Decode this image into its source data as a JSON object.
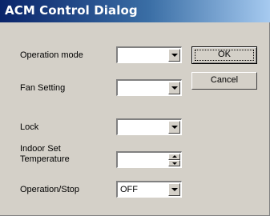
{
  "window": {
    "title": "ACM Control Dialog"
  },
  "form": {
    "operation_mode": {
      "label": "Operation mode",
      "value": ""
    },
    "fan_setting": {
      "label": "Fan Setting",
      "value": ""
    },
    "lock": {
      "label": "Lock",
      "value": ""
    },
    "indoor_set_temperature": {
      "label_line1": "Indoor Set",
      "label_line2": "Temperature",
      "value": ""
    },
    "operation_stop": {
      "label": "Operation/Stop",
      "value": "OFF"
    }
  },
  "buttons": {
    "ok": "OK",
    "cancel": "Cancel"
  }
}
